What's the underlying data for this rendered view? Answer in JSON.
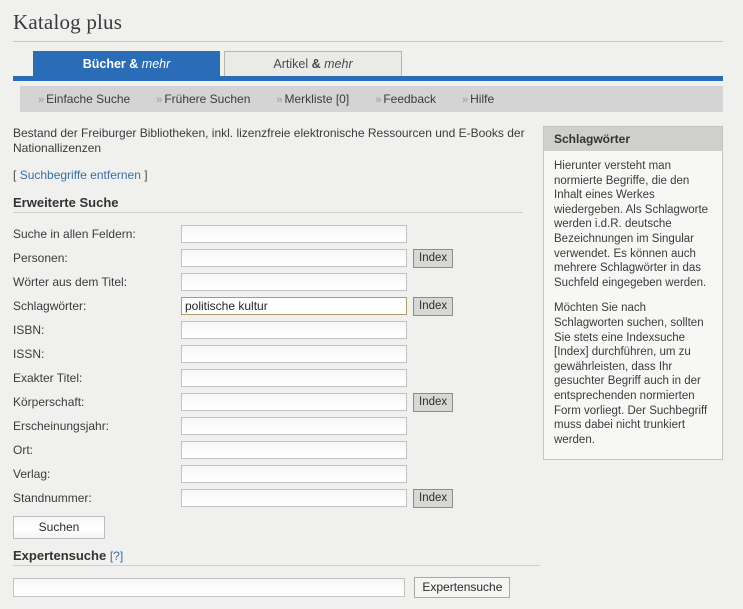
{
  "header": {
    "title": "Katalog plus"
  },
  "tabs": [
    {
      "label_bold": "Bücher",
      "amp": "&",
      "label_italic": "mehr",
      "active": true
    },
    {
      "label_bold": "Artikel",
      "amp": "&",
      "label_italic": "mehr",
      "active": false
    }
  ],
  "nav": {
    "chevron": "»",
    "items": [
      {
        "label": "Einfache Suche"
      },
      {
        "label": "Frühere Suchen"
      },
      {
        "label": "Merkliste [0]"
      },
      {
        "label": "Feedback"
      },
      {
        "label": "Hilfe"
      }
    ]
  },
  "main": {
    "blurb": "Bestand der Freiburger Bibliotheken, inkl. lizenzfreie elektronische Ressourcen und E-Books der Nationallizenzen",
    "remove_terms_open": "[",
    "remove_terms_link": "Suchbegriffe entfernen",
    "remove_terms_close": "]",
    "advanced_heading": "Erweiterte Suche",
    "fields": [
      {
        "label": "Suche in allen Feldern:",
        "value": "",
        "index_button": null,
        "highlight": false
      },
      {
        "label": "Personen:",
        "value": "",
        "index_button": "Index",
        "highlight": false
      },
      {
        "label": "Wörter aus dem Titel:",
        "value": "",
        "index_button": null,
        "highlight": false
      },
      {
        "label": "Schlagwörter:",
        "value": "politische kultur",
        "index_button": "Index",
        "highlight": true
      },
      {
        "label": "ISBN:",
        "value": "",
        "index_button": null,
        "highlight": false
      },
      {
        "label": "ISSN:",
        "value": "",
        "index_button": null,
        "highlight": false
      },
      {
        "label": "Exakter Titel:",
        "value": "",
        "index_button": null,
        "highlight": false
      },
      {
        "label": "Körperschaft:",
        "value": "",
        "index_button": "Index",
        "highlight": false
      },
      {
        "label": "Erscheinungsjahr:",
        "value": "",
        "index_button": null,
        "highlight": false
      },
      {
        "label": "Ort:",
        "value": "",
        "index_button": null,
        "highlight": false
      },
      {
        "label": "Verlag:",
        "value": "",
        "index_button": null,
        "highlight": false
      },
      {
        "label": "Standnummer:",
        "value": "",
        "index_button": "Index",
        "highlight": false
      }
    ],
    "search_button": "Suchen"
  },
  "sidebar": {
    "title": "Schlagwörter",
    "paragraphs": [
      "Hierunter versteht man normierte Begriffe, die den Inhalt eines Werkes wiedergeben. Als Schlagworte werden i.d.R. deutsche Bezeichnungen im Singular verwendet. Es können auch mehrere Schlagwörter in das Suchfeld eingegeben werden.",
      "Möchten Sie nach Schlagworten suchen, sollten Sie stets eine Indexsuche [Index] durchführen, um zu gewährleisten, dass Ihr gesuchter Begriff auch in der entsprechenden normierten Form vorliegt. Der Suchbegriff muss dabei nicht trunkiert werden."
    ]
  },
  "expert": {
    "heading": "Expertensuche",
    "help_label": "[?]",
    "input_value": "",
    "button_label": "Expertensuche"
  },
  "colors": {
    "accent_blue": "#2a6cb5",
    "link_blue": "#3a6ea5",
    "nav_gray": "#d4d4d4",
    "page_bg": "#f0f0ef",
    "highlight_border": "#b09a6a"
  }
}
